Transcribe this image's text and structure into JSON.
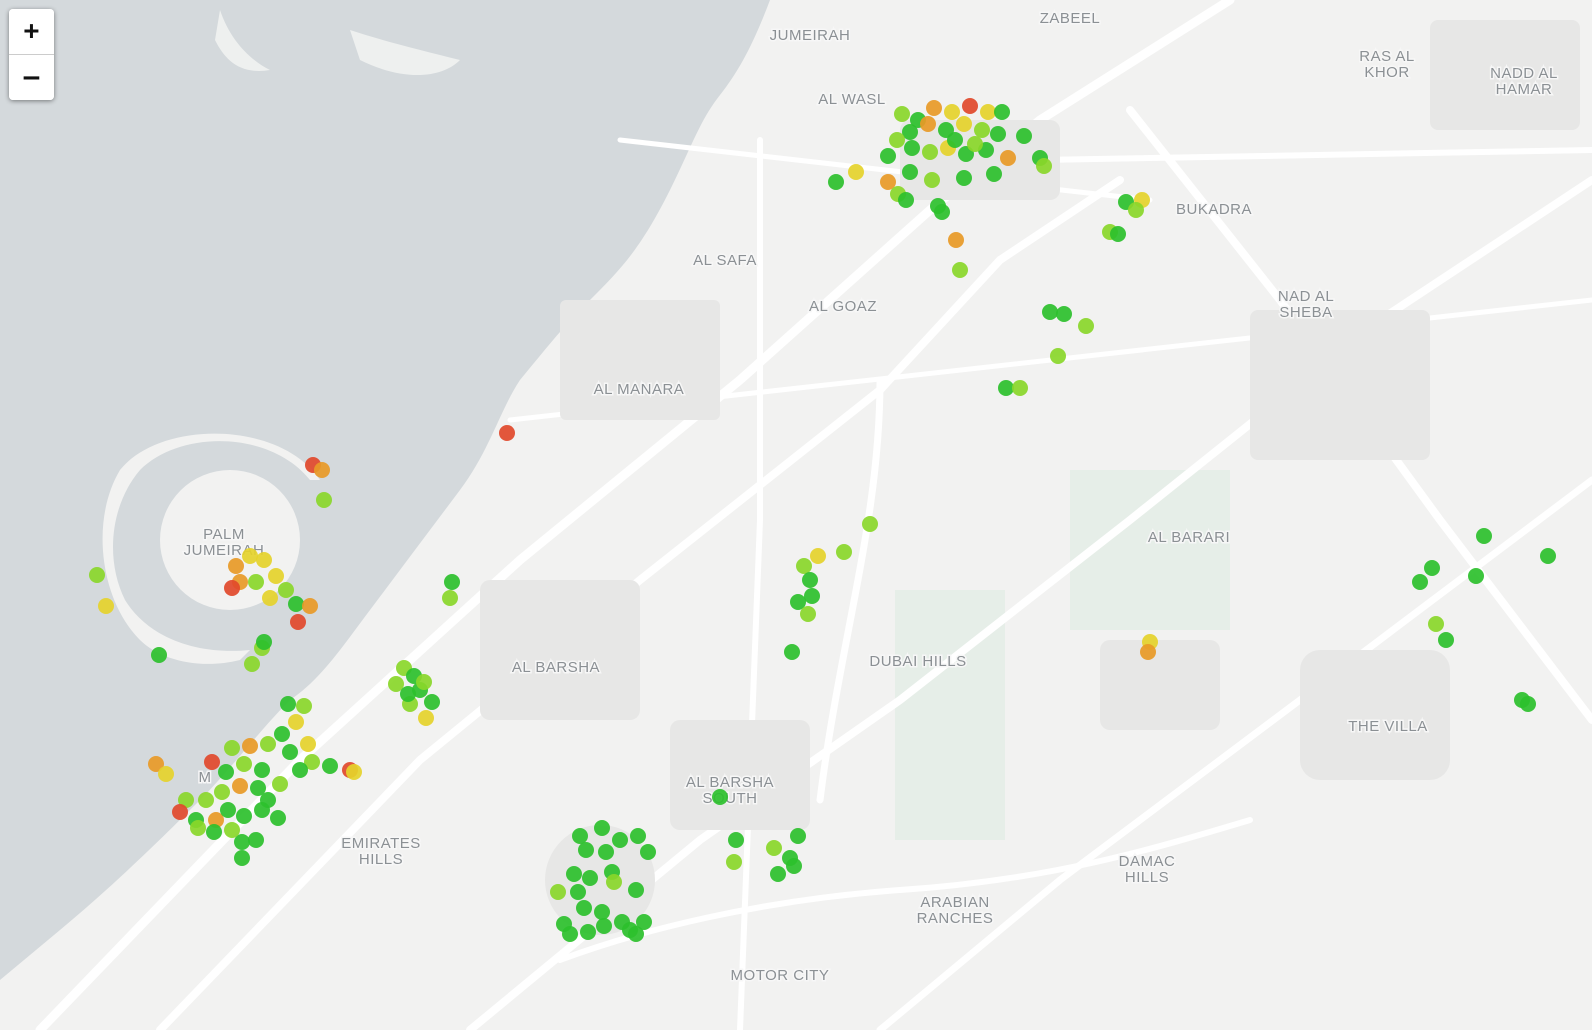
{
  "map": {
    "zoom_in_label": "+",
    "zoom_out_label": "–",
    "colors": {
      "sea": "#d4d9dc",
      "land": "#f2f2f1",
      "road": "#ffffff",
      "block": "#e4e4e3",
      "park": "#e6eee8",
      "label": "#8b9094",
      "marker_green": "#2cc02c",
      "marker_lightgreen": "#8ad72a",
      "marker_yellow": "#e5d32b",
      "marker_orange": "#e89a27",
      "marker_red": "#e1492b"
    },
    "place_labels": [
      {
        "lines": [
          "JUMEIRAH"
        ]
      },
      {
        "lines": [
          "ZABEEL"
        ]
      },
      {
        "lines": [
          "RAS AL",
          "KHOR"
        ]
      },
      {
        "lines": [
          "NADD AL",
          "HAMAR"
        ]
      },
      {
        "lines": [
          "AL WASL"
        ]
      },
      {
        "lines": [
          "BUKADRA"
        ]
      },
      {
        "lines": [
          "AL SAFA"
        ]
      },
      {
        "lines": [
          "AL GOAZ"
        ]
      },
      {
        "lines": [
          "NAD AL",
          "SHEBA"
        ]
      },
      {
        "lines": [
          "AL MANARA"
        ]
      },
      {
        "lines": [
          "PALM",
          "JUMEIRAH"
        ]
      },
      {
        "lines": [
          "AL BARARI"
        ]
      },
      {
        "lines": [
          "AL BARSHA"
        ]
      },
      {
        "lines": [
          "DUBAI HILLS"
        ]
      },
      {
        "lines": [
          "THE VILLA"
        ]
      },
      {
        "lines": [
          "AL BARSHA",
          "SOUTH"
        ]
      },
      {
        "lines": [
          "EMIRATES",
          "HILLS"
        ]
      },
      {
        "lines": [
          "DAMAC",
          "HILLS"
        ]
      },
      {
        "lines": [
          "ARABIAN",
          "RANCHES"
        ]
      },
      {
        "lines": [
          "MOTOR CITY"
        ]
      },
      {
        "lines": [
          "M"
        ]
      }
    ]
  }
}
